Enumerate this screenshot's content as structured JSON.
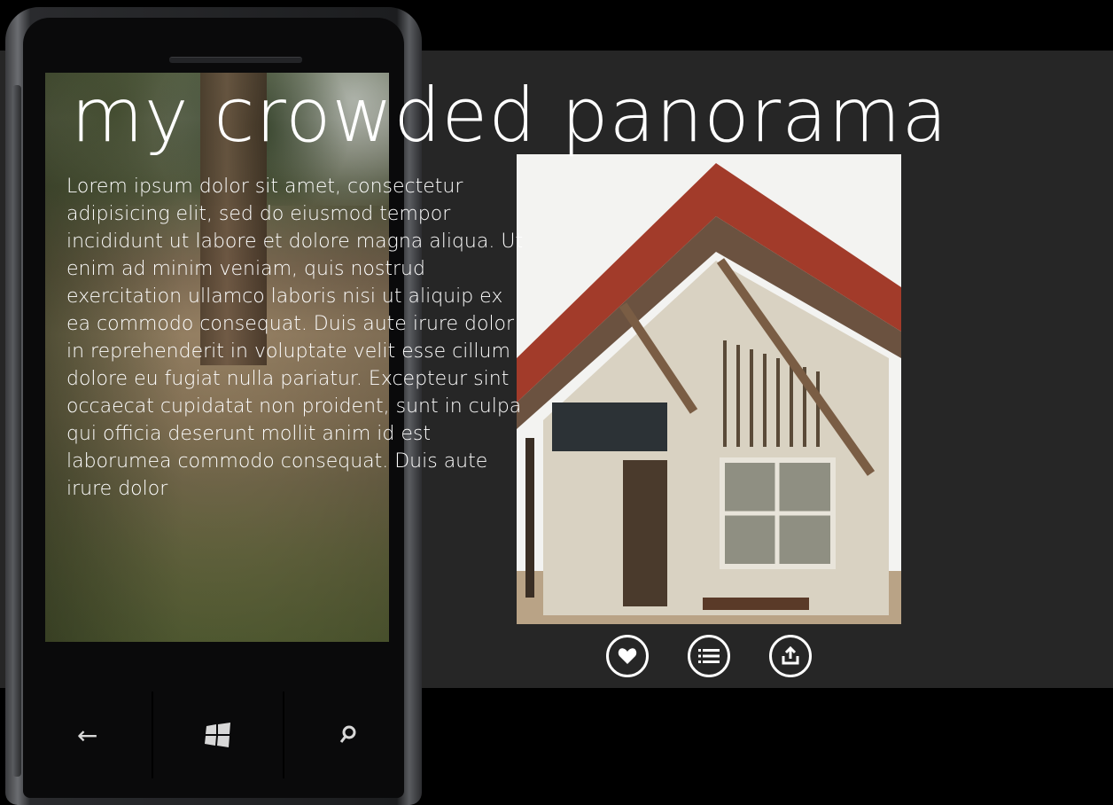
{
  "panorama": {
    "title": "my crowded panorama",
    "body": "Lorem ipsum dolor sit amet, consectetur adipisicing elit, sed do eiusmod tempor incididunt ut labore et dolore magna aliqua. Ut enim ad minim veniam, quis nostrud exercitation ullamco laboris nisi ut aliquip ex ea commodo consequat. Duis aute irure dolor in reprehenderit in voluptate velit esse cillum dolore eu fugiat nulla pariatur. Excepteur sint occaecat cupidatat non proident, sunt in culpa qui officia deserunt mollit anim id est laborumea commodo consequat. Duis aute irure dolor"
  },
  "photo": {
    "description_icon": "train-station-photo"
  },
  "appbar": {
    "buttons": [
      {
        "icon": "heart-icon"
      },
      {
        "icon": "list-icon"
      },
      {
        "icon": "upload-icon"
      }
    ]
  },
  "hardware_keys": [
    {
      "icon": "back-arrow-icon",
      "glyph": "←"
    },
    {
      "icon": "windows-start-icon",
      "glyph": "⊞"
    },
    {
      "icon": "search-icon",
      "glyph": "⚲"
    }
  ]
}
